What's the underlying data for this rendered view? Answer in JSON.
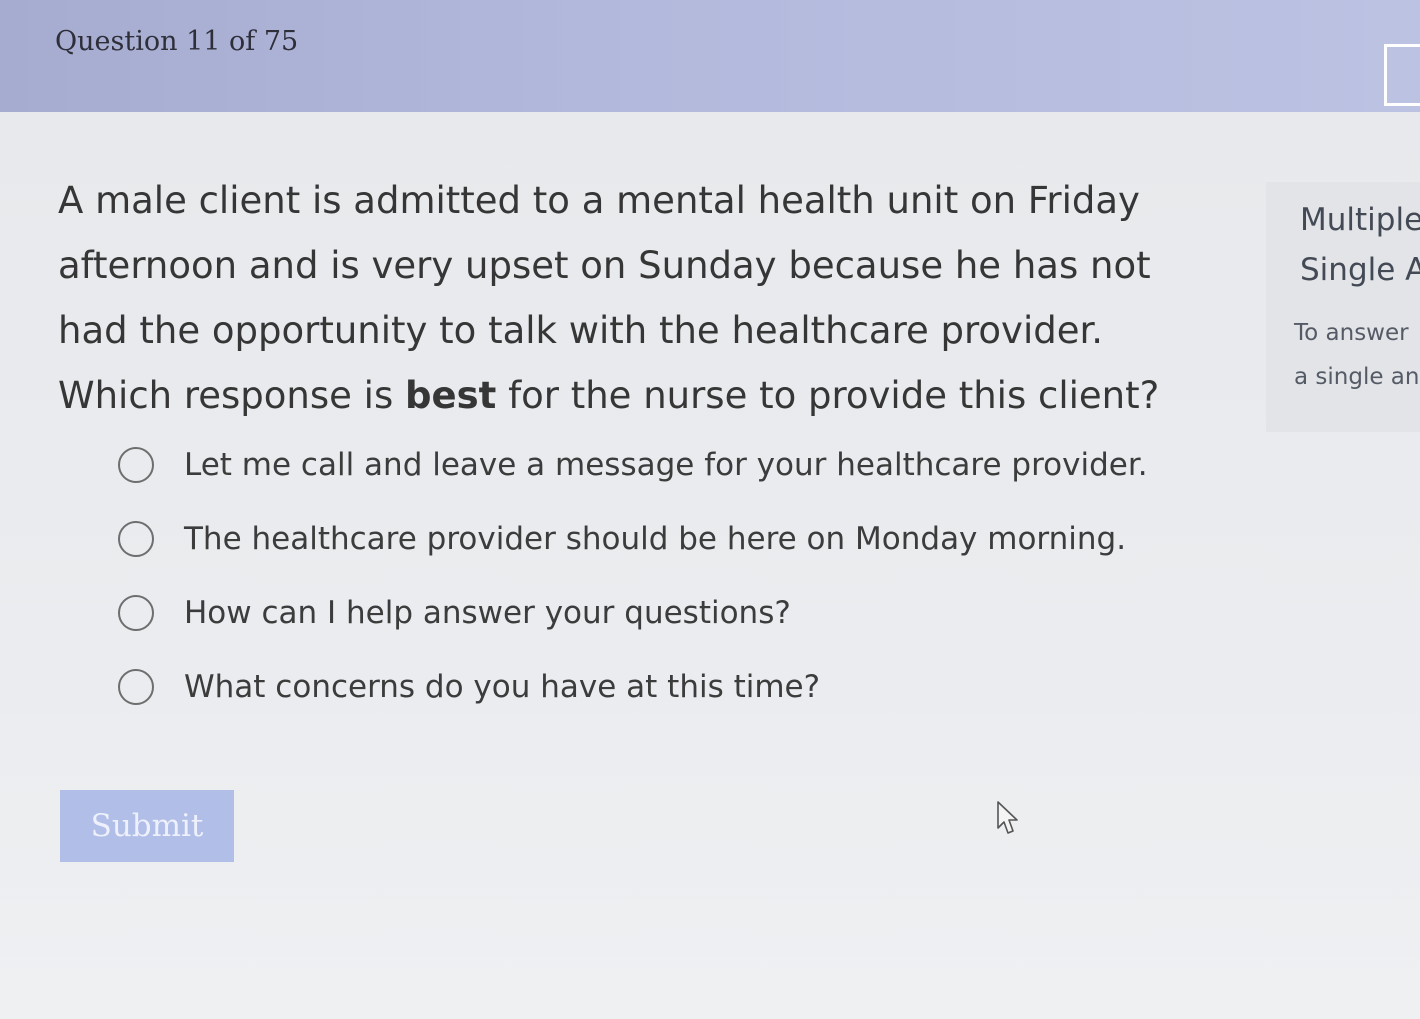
{
  "header": {
    "question_counter": "Question 11 of 75"
  },
  "question": {
    "stem_before": "A male client is admitted to a mental health unit on Friday afternoon and is very upset on Sunday because he has not had the opportunity to talk with the healthcare provider. Which response is ",
    "stem_emphasis": "best",
    "stem_after": " for the nurse to provide this client?",
    "options": [
      {
        "label": "Let me call and leave a message for your healthcare provider.",
        "selected": false
      },
      {
        "label": "The healthcare provider should be here on Monday morning.",
        "selected": false
      },
      {
        "label": "How can I help answer your questions?",
        "selected": false
      },
      {
        "label": "What concerns do you have at this time?",
        "selected": false
      }
    ]
  },
  "actions": {
    "submit_label": "Submit"
  },
  "side_panel": {
    "title_line1": "Multiple",
    "title_line2": "Single A",
    "note_line1": "To answer",
    "note_line2": "a single an"
  },
  "icons": {
    "flag": "flag-box-icon",
    "cursor": "mouse-pointer-icon",
    "option_radio": "radio-circle-icon"
  },
  "colors": {
    "header_bg": "#b3b9dc",
    "submit_bg": "#b1bee7",
    "text": "#363636"
  }
}
